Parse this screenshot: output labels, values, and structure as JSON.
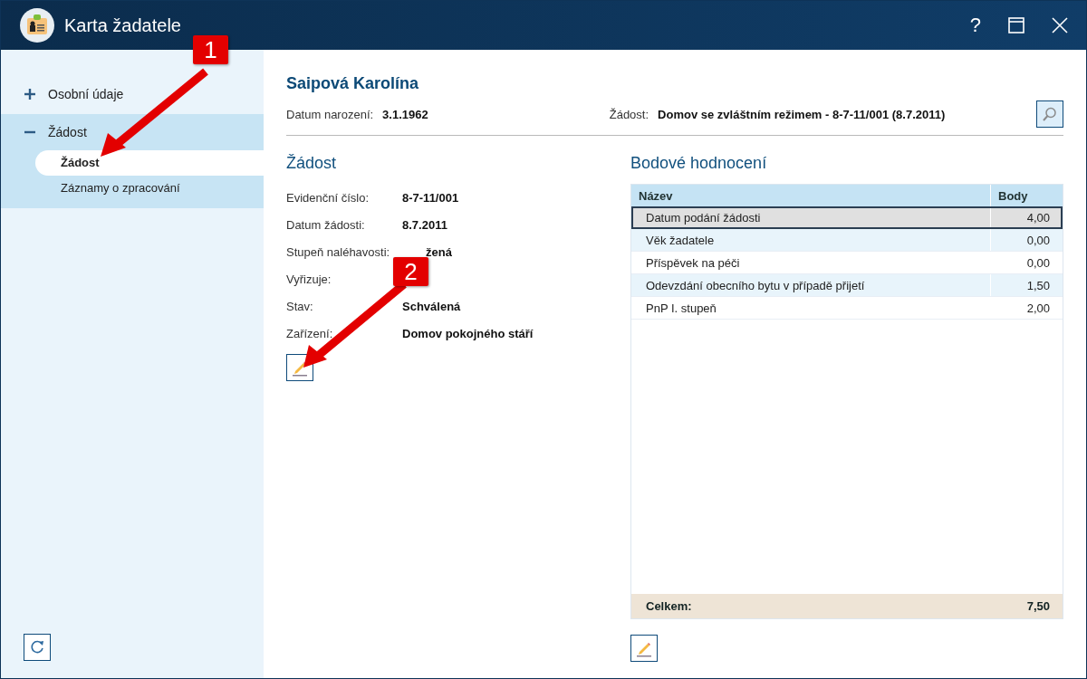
{
  "window": {
    "title": "Karta žadatele",
    "help": "?"
  },
  "sidebar": {
    "items": [
      {
        "label": "Osobní údaje",
        "expanded": false
      },
      {
        "label": "Žádost",
        "expanded": true,
        "children": [
          {
            "label": "Žádost",
            "selected": true
          },
          {
            "label": "Záznamy o zpracování",
            "selected": false
          }
        ]
      }
    ]
  },
  "header": {
    "name": "Saipová Karolína",
    "birth_label": "Datum narození:",
    "birth_value": "3.1.1962",
    "request_label": "Žádost:",
    "request_value": "Domov se zvláštním režimem - 8-7-11/001 (8.7.2011)"
  },
  "request": {
    "title": "Žádost",
    "fields": [
      {
        "label": "Evidenční číslo:",
        "value": "8-7-11/001"
      },
      {
        "label": "Datum žádosti:",
        "value": "8.7.2011"
      },
      {
        "label": "Stupeň naléhavosti:",
        "value": "žená",
        "covered": true
      },
      {
        "label": "Vyřizuje:"
      },
      {
        "label": "Stav:",
        "value": "Schválená"
      },
      {
        "label": "Zařízení:",
        "value": "Domov pokojného stáří"
      }
    ]
  },
  "scoring": {
    "title": "Bodové hodnocení",
    "columns": [
      "Název",
      "Body"
    ],
    "rows": [
      {
        "name": "Datum podání žádosti",
        "points": "4,00",
        "selected": true
      },
      {
        "name": "Věk žadatele",
        "points": "0,00",
        "selected": false
      },
      {
        "name": "Příspěvek na péči",
        "points": "0,00",
        "selected": false
      },
      {
        "name": "Odevzdání obecního bytu v případě přijetí",
        "points": "1,50",
        "selected": false
      },
      {
        "name": "PnP I. stupeň",
        "points": "2,00",
        "selected": false
      }
    ],
    "total_label": "Celkem:",
    "total_value": "7,50"
  },
  "callouts": [
    {
      "label": "1"
    },
    {
      "label": "2"
    }
  ]
}
